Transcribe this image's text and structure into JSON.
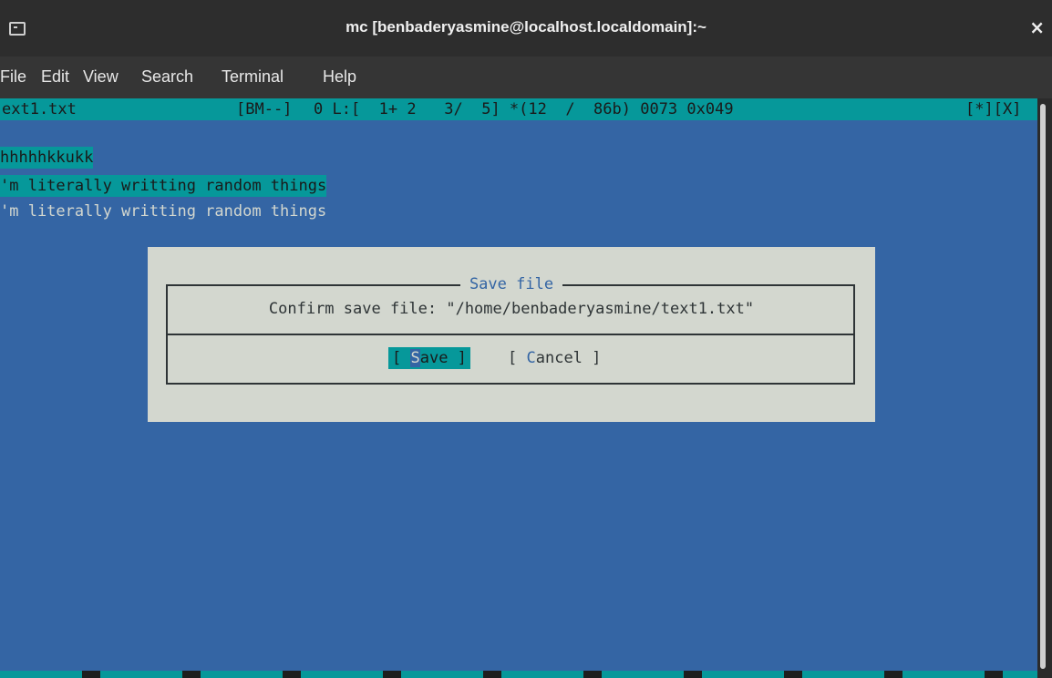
{
  "window": {
    "title": "mc [benbaderyasmine@localhost.localdomain]:~",
    "close_glyph": "×"
  },
  "menu": [
    "File",
    "Edit",
    "View",
    "Search",
    "Terminal",
    "Help"
  ],
  "status": {
    "filename": "ext1.txt",
    "mode": "[BM--]",
    "col": "0 L:[  1+ 2   3/  5] *(12  /  86b) 0073 0x049",
    "flags": "[*][X]"
  },
  "editor": {
    "lines": [
      "hhhhhkkukk",
      "'m literally writting random things",
      "'m literally writting random things"
    ]
  },
  "dialog": {
    "title": "Save file",
    "message": "Confirm save file: \"/home/benbaderyasmine/text1.txt\"",
    "save_button": {
      "prefix": "[ ",
      "hotkey": "S",
      "rest": "ave ]"
    },
    "cancel_button": {
      "prefix": "[ ",
      "hotkey": "C",
      "rest": "ancel ]"
    }
  }
}
